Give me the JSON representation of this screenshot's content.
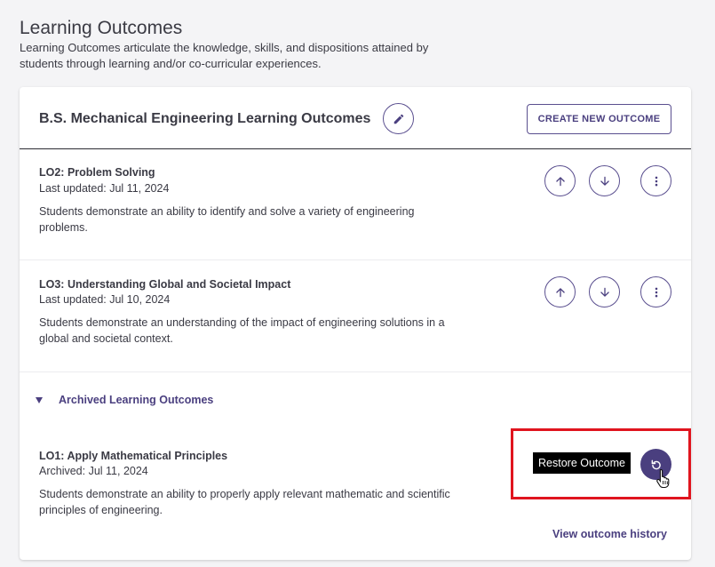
{
  "page": {
    "title": "Learning Outcomes",
    "description": "Learning Outcomes articulate the knowledge, skills, and dispositions attained by students through learning and/or co-curricular experiences."
  },
  "card": {
    "title": "B.S. Mechanical Engineering Learning Outcomes",
    "create_label": "CREATE NEW OUTCOME"
  },
  "outcomes": [
    {
      "title": "LO2: Problem Solving",
      "date": "Last updated: Jul 11, 2024",
      "description": "Students demonstrate an ability to identify and solve a variety of engineering problems."
    },
    {
      "title": "LO3: Understanding Global and Societal Impact",
      "date": "Last updated: Jul 10, 2024",
      "description": "Students demonstrate an understanding of the impact of engineering solutions in a global and societal context."
    }
  ],
  "archived": {
    "toggle_label": "Archived Learning Outcomes",
    "items": [
      {
        "title": "LO1: Apply Mathematical Principles",
        "date": "Archived: Jul 11, 2024",
        "description": "Students demonstrate an ability to properly apply relevant mathematic and scientific principles of engineering."
      }
    ],
    "restore_tooltip": "Restore Outcome",
    "history_link": "View outcome history"
  },
  "icons": {
    "edit": "pencil-icon",
    "up": "arrow-up-icon",
    "down": "arrow-down-icon",
    "menu": "more-vertical-icon",
    "restore": "restore-icon",
    "caret": "caret-down-icon",
    "cursor": "hand-pointer-icon"
  },
  "colors": {
    "accent": "#4a3f7f",
    "highlight": "#e0141e",
    "tooltip_bg": "#000000"
  }
}
